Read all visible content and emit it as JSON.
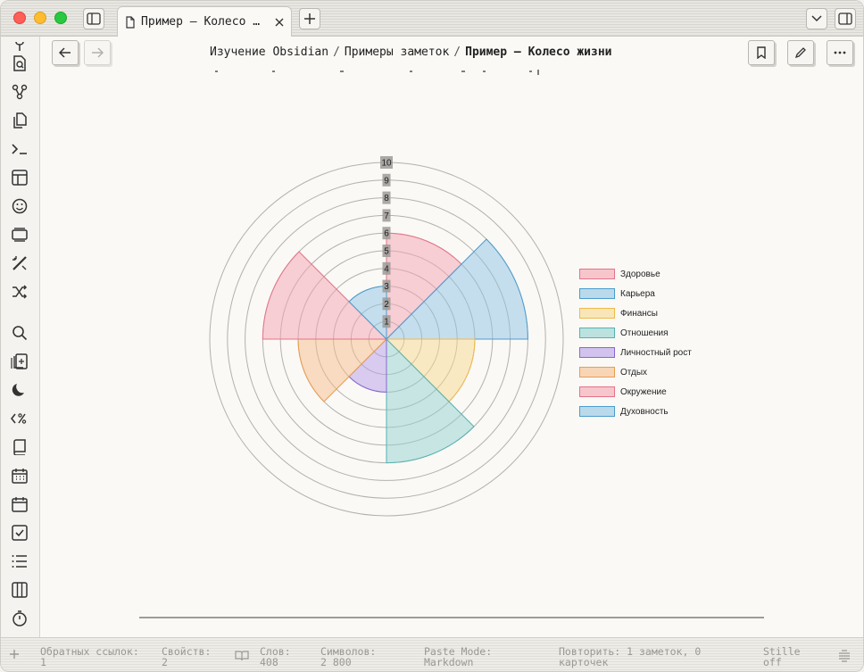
{
  "tab": {
    "title": "Пример — Колесо …"
  },
  "breadcrumb": {
    "parts": [
      "Изучение Obsidian",
      "Примеры заметок"
    ],
    "current": "Пример — Колесо жизни",
    "separator": "/"
  },
  "chart_data": {
    "type": "polarArea",
    "title": "",
    "r_range": [
      0,
      10
    ],
    "r_ticks": [
      1,
      2,
      3,
      4,
      5,
      6,
      7,
      8,
      9,
      10
    ],
    "categories": [
      "Здоровье",
      "Карьера",
      "Финансы",
      "Отношения",
      "Личностный рост",
      "Отдых",
      "Окружение",
      "Духовность"
    ],
    "values": [
      6,
      8,
      5,
      7,
      3,
      5,
      7,
      3
    ],
    "colors": [
      "#f4a3b1",
      "#8fc3e3",
      "#f8d98f",
      "#93d2d0",
      "#b59ee8",
      "#f5bd8a",
      "#f4a3b1",
      "#8fc3e3"
    ],
    "strokes": [
      "#e57389",
      "#4b9ccd",
      "#eeb94b",
      "#53b3b0",
      "#8a67d3",
      "#e99d52",
      "#e57389",
      "#4b9ccd"
    ],
    "legend_position": "right",
    "grid": true
  },
  "status": {
    "backlinks_label": "Обратных ссылок:",
    "backlinks_value": "1",
    "props_label": "Свойств:",
    "props_value": "2",
    "words_label": "Слов:",
    "words_value": "408",
    "chars_label": "Символов:",
    "chars_value": "2 800",
    "paste_label": "Paste Mode:",
    "paste_value": "Markdown",
    "review_line1": "Повторить: 1 заметок, 0",
    "review_line2": "карточек",
    "stille_line1": "Stille",
    "stille_line2": "off"
  },
  "icons": {
    "ribbon": [
      "map-pin-icon",
      "file-search-icon",
      "graph-icon",
      "files-icon",
      "terminal-icon",
      "layout-icon",
      "smiley-icon",
      "slides-icon",
      "magic-wand-icon",
      "shuffle-icon",
      "search-icon",
      "flashcards-icon",
      "moon-icon",
      "regex-icon",
      "book-icon",
      "calendar-grid-icon",
      "calendar-icon",
      "checkbox-icon",
      "list-icon",
      "columns-icon",
      "timer-icon"
    ]
  }
}
